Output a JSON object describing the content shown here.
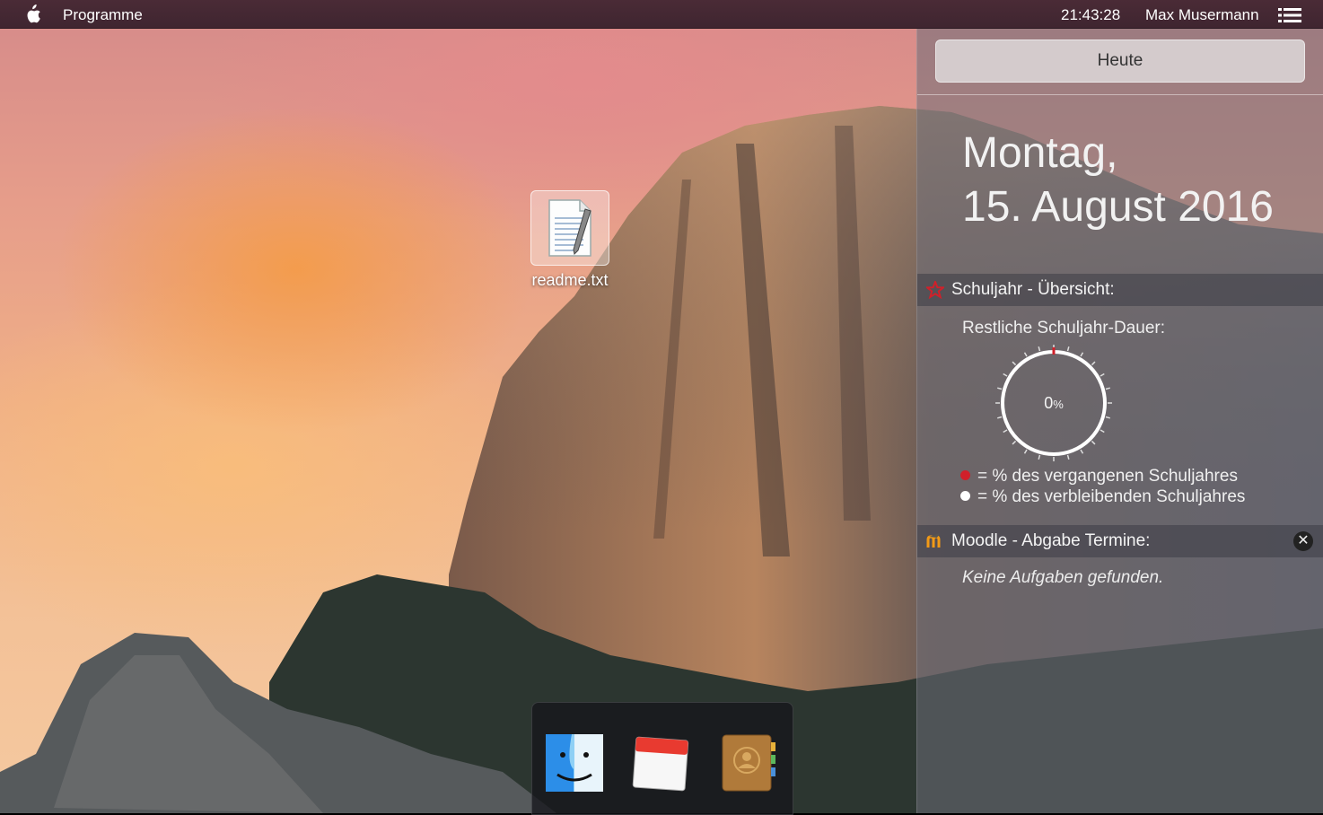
{
  "menubar": {
    "apple_icon": "apple-logo-icon",
    "apps_label": "Programme",
    "clock": "21:43:28",
    "user": "Max Musermann",
    "list_icon": "list-icon"
  },
  "desktop": {
    "file_label": "readme.txt",
    "file_icon": "text-document-icon"
  },
  "notification_center": {
    "today_label": "Heute",
    "date_day": "Montag,",
    "date_full": "15. August 2016",
    "school_widget": {
      "title": "Schuljahr - Übersicht:",
      "icon": "star-icon",
      "remaining_label": "Restliche Schuljahr-Dauer:",
      "percent_value": "0",
      "percent_unit": "%",
      "progress": 0.0,
      "legend_past": "= % des vergangenen Schuljahres",
      "legend_remaining": "= % des verbleibenden Schuljahres",
      "past_color": "#d0202a",
      "remaining_color": "#ffffff"
    },
    "moodle_widget": {
      "title": "Moodle - Abgabe Termine:",
      "icon": "moodle-icon",
      "close_label": "✕",
      "empty_text": "Keine Aufgaben gefunden."
    }
  },
  "dock": {
    "apps": [
      "finder-icon",
      "calendar-icon",
      "contacts-icon"
    ]
  }
}
